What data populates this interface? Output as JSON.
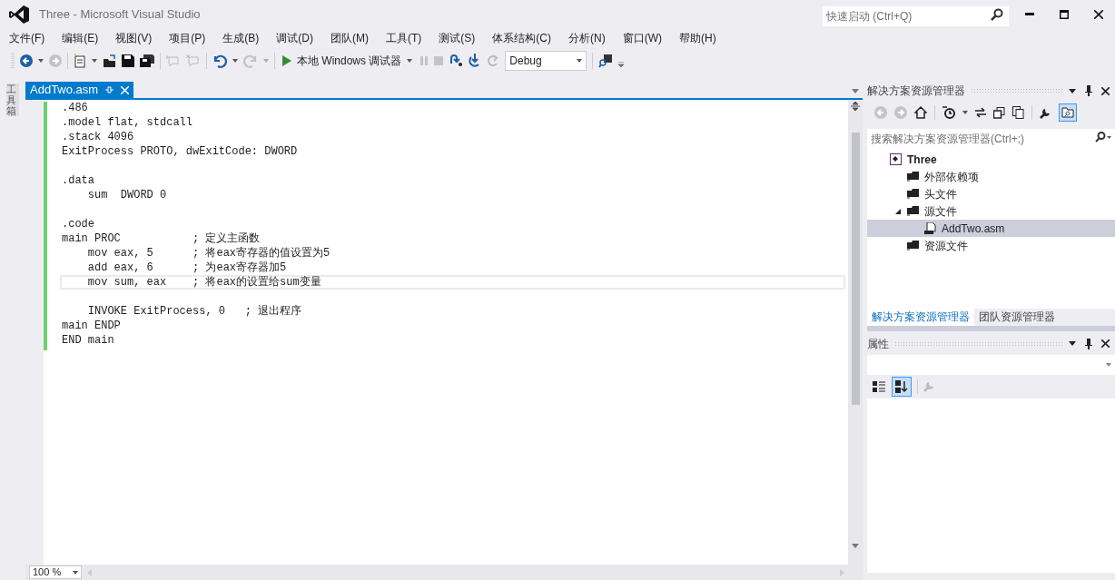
{
  "window": {
    "title": "Three - Microsoft Visual Studio"
  },
  "quick_launch": {
    "placeholder": "快速启动 (Ctrl+Q)"
  },
  "menu": [
    "文件(F)",
    "编辑(E)",
    "视图(V)",
    "项目(P)",
    "生成(B)",
    "调试(D)",
    "团队(M)",
    "工具(T)",
    "测试(S)",
    "体系结构(C)",
    "分析(N)",
    "窗口(W)",
    "帮助(H)"
  ],
  "toolbar": {
    "run_label": "本地 Windows 调试器",
    "configuration": "Debug"
  },
  "toolbox_strip": {
    "label": "工具箱"
  },
  "editor": {
    "tabs": [
      {
        "label": "AddTwo.asm",
        "selected": true
      }
    ],
    "lines": [
      {
        "text": ".486",
        "current": false
      },
      {
        "text": ".model flat, stdcall",
        "current": false
      },
      {
        "text": ".stack 4096",
        "current": false
      },
      {
        "text": "ExitProcess PROTO, dwExitCode: DWORD",
        "current": false
      },
      {
        "current": false
      },
      {
        "text": ".data",
        "current": false
      },
      {
        "text": "    sum  DWORD 0",
        "current": false
      },
      {
        "current": false
      },
      {
        "text": ".code",
        "current": false
      },
      {
        "text": "main PROC           ; 定义主函数",
        "current": false
      },
      {
        "text": "    mov eax, 5      ; 将eax寄存器的值设置为5",
        "current": false
      },
      {
        "text": "    add eax, 6      ; 为eax寄存器加5",
        "current": false
      },
      {
        "text": "    mov sum, eax    ; 将eax的设置给sum变量",
        "current": true
      },
      {
        "current": false
      },
      {
        "text": "    INVOKE ExitProcess, 0   ; 退出程序",
        "current": false
      },
      {
        "text": "main ENDP",
        "current": false
      },
      {
        "text": "END main",
        "current": false
      }
    ],
    "zoom": "100 %"
  },
  "solution_explorer": {
    "title": "解决方案资源管理器",
    "search": {
      "placeholder": "搜索解决方案资源管理器(Ctrl+;)"
    },
    "tree": [
      {
        "label": "Three",
        "kind": "solution",
        "selected": false,
        "children": [
          {
            "label": "外部依赖项",
            "kind": "folder",
            "selected": false
          },
          {
            "label": "头文件",
            "kind": "folder",
            "selected": false
          },
          {
            "label": "源文件",
            "kind": "folder",
            "selected": false,
            "expanded": true,
            "children": [
              {
                "label": "AddTwo.asm",
                "kind": "file",
                "selected": true
              }
            ]
          },
          {
            "label": "资源文件",
            "kind": "folder",
            "selected": false
          }
        ]
      }
    ],
    "tabs": [
      {
        "label": "解决方案资源管理器",
        "selected": true
      },
      {
        "label": "团队资源管理器",
        "selected": false
      }
    ]
  },
  "properties": {
    "title": "属性"
  }
}
